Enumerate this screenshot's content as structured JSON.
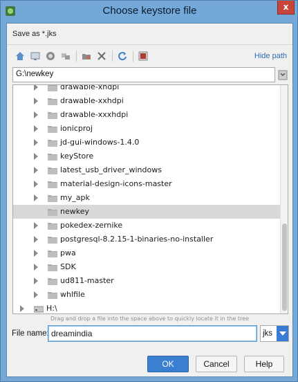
{
  "window": {
    "title": "Choose keystore file",
    "close_label": "x"
  },
  "dialog": {
    "subtitle": "Save as *.jks"
  },
  "toolbar": {
    "hide_path_label": "Hide path",
    "buttons": [
      "home-icon",
      "desktop-icon",
      "project-icon",
      "module-icon",
      "new-folder-icon",
      "delete-icon",
      "refresh-icon",
      "show-hidden-icon"
    ]
  },
  "path": {
    "value": "G:\\newkey"
  },
  "tree": {
    "items": [
      {
        "label": "drawable-xhdpi",
        "selected": false,
        "expandable": true
      },
      {
        "label": "drawable-xxhdpi",
        "selected": false,
        "expandable": true
      },
      {
        "label": "drawable-xxxhdpi",
        "selected": false,
        "expandable": true
      },
      {
        "label": "ionicproj",
        "selected": false,
        "expandable": true
      },
      {
        "label": "jd-gui-windows-1.4.0",
        "selected": false,
        "expandable": true
      },
      {
        "label": "keyStore",
        "selected": false,
        "expandable": true
      },
      {
        "label": "latest_usb_driver_windows",
        "selected": false,
        "expandable": true
      },
      {
        "label": "material-design-icons-master",
        "selected": false,
        "expandable": true
      },
      {
        "label": "my_apk",
        "selected": false,
        "expandable": true
      },
      {
        "label": "newkey",
        "selected": true,
        "expandable": false
      },
      {
        "label": "pokedex-zernike",
        "selected": false,
        "expandable": true
      },
      {
        "label": "postgresql-8.2.15-1-binaries-no-installer",
        "selected": false,
        "expandable": true
      },
      {
        "label": "pwa",
        "selected": false,
        "expandable": true
      },
      {
        "label": "SDK",
        "selected": false,
        "expandable": true
      },
      {
        "label": "ud811-master",
        "selected": false,
        "expandable": true
      },
      {
        "label": "whlfile",
        "selected": false,
        "expandable": true
      },
      {
        "label": "H:\\",
        "selected": false,
        "expandable": true,
        "drive": true
      }
    ]
  },
  "hint": "Drag and drop a file into the space above to quickly locate it in the tree",
  "filename": {
    "label": "File name:",
    "value": "dreamindia",
    "extension": "jks"
  },
  "buttons": {
    "ok": "OK",
    "cancel": "Cancel",
    "help": "Help"
  },
  "colors": {
    "accent": "#3b7fd0",
    "selection": "#d8d8d8",
    "link": "#2e6db0"
  }
}
